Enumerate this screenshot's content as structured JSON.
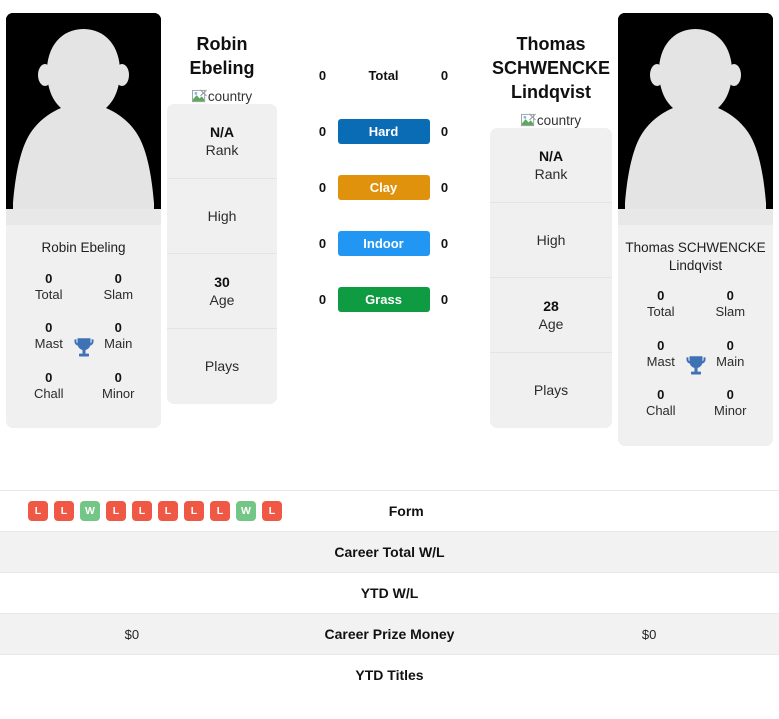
{
  "players": {
    "left": {
      "name_line1": "Robin",
      "name_line2": "Ebeling",
      "full_name": "Robin Ebeling",
      "country_alt": "country",
      "avatar_name": "player-silhouette-icon",
      "titles": {
        "total_value": "0",
        "total_label": "Total",
        "slam_value": "0",
        "slam_label": "Slam",
        "mast_value": "0",
        "mast_label": "Mast",
        "main_value": "0",
        "main_label": "Main",
        "chall_value": "0",
        "chall_label": "Chall",
        "minor_value": "0",
        "minor_label": "Minor"
      },
      "attributes": [
        {
          "value": "N/A",
          "label": "Rank"
        },
        {
          "value": "",
          "label": "High"
        },
        {
          "value": "30",
          "label": "Age"
        },
        {
          "value": "",
          "label": "Plays"
        }
      ],
      "surface_counts": {
        "total": "0",
        "hard": "0",
        "clay": "0",
        "indoor": "0",
        "grass": "0"
      },
      "career_prize_money": "$0",
      "career_total_wl": "",
      "ytd_wl": "",
      "ytd_titles": "",
      "form": [
        {
          "result": "L",
          "type": "loss"
        },
        {
          "result": "L",
          "type": "loss"
        },
        {
          "result": "W",
          "type": "win"
        },
        {
          "result": "L",
          "type": "loss"
        },
        {
          "result": "L",
          "type": "loss"
        },
        {
          "result": "L",
          "type": "loss"
        },
        {
          "result": "L",
          "type": "loss"
        },
        {
          "result": "L",
          "type": "loss"
        },
        {
          "result": "W",
          "type": "win"
        },
        {
          "result": "L",
          "type": "loss"
        }
      ]
    },
    "right": {
      "name_line1": "Thomas",
      "name_line2": "SCHWENCKE",
      "name_line3": "Lindqvist",
      "full_name_line1": "Thomas SCHWENCKE",
      "full_name_line2": "Lindqvist",
      "country_alt": "country",
      "avatar_name": "player-silhouette-icon",
      "titles": {
        "total_value": "0",
        "total_label": "Total",
        "slam_value": "0",
        "slam_label": "Slam",
        "mast_value": "0",
        "mast_label": "Mast",
        "main_value": "0",
        "main_label": "Main",
        "chall_value": "0",
        "chall_label": "Chall",
        "minor_value": "0",
        "minor_label": "Minor"
      },
      "attributes": [
        {
          "value": "N/A",
          "label": "Rank"
        },
        {
          "value": "",
          "label": "High"
        },
        {
          "value": "28",
          "label": "Age"
        },
        {
          "value": "",
          "label": "Plays"
        }
      ],
      "surface_counts": {
        "total": "0",
        "hard": "0",
        "clay": "0",
        "indoor": "0",
        "grass": "0"
      },
      "career_prize_money": "$0",
      "career_total_wl": "",
      "ytd_wl": "",
      "ytd_titles": "",
      "form": []
    }
  },
  "surfaces": [
    {
      "key": "total",
      "label": "Total",
      "color": "transparent",
      "plain": true
    },
    {
      "key": "hard",
      "label": "Hard",
      "color": "#0a6cb4",
      "plain": false
    },
    {
      "key": "clay",
      "label": "Clay",
      "color": "#e0920c",
      "plain": false
    },
    {
      "key": "indoor",
      "label": "Indoor",
      "color": "#2196f3",
      "plain": false
    },
    {
      "key": "grass",
      "label": "Grass",
      "color": "#0e9b41",
      "plain": false
    }
  ],
  "table_rows": [
    {
      "label": "Form",
      "alt": false
    },
    {
      "label": "Career Total W/L",
      "alt": true
    },
    {
      "label": "YTD W/L",
      "alt": false
    },
    {
      "label": "Career Prize Money",
      "alt": true
    },
    {
      "label": "YTD Titles",
      "alt": false
    }
  ],
  "colors": {
    "win_badge": "#74c686",
    "loss_badge": "#ef5844",
    "card_bg": "#f0f0f0",
    "row_alt_bg": "#f2f2f2",
    "trophy": "#3f72b5",
    "avatar_bg": "#000000",
    "avatar_fig": "#e4e4e4"
  }
}
